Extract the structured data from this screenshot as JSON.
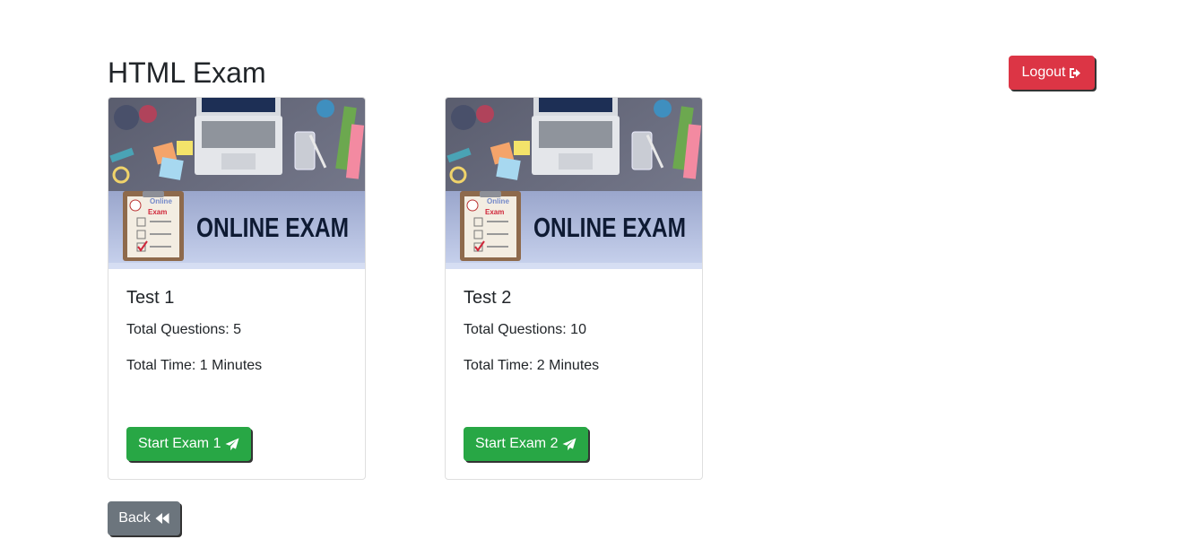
{
  "page": {
    "title": "HTML Exam"
  },
  "header": {
    "logout_label": "Logout",
    "logout_icon": "sign-out-icon"
  },
  "colors": {
    "danger": "#dc3545",
    "success": "#28a745",
    "secondary": "#6c757d"
  },
  "exams": [
    {
      "title": "Test 1",
      "total_questions": "Total Questions: 5",
      "total_time": "Total Time: 1 Minutes",
      "start_label": "Start Exam 1",
      "start_icon": "paper-plane-icon",
      "image_text": "ONLINE EXAM",
      "clipboard_text_1": "Online",
      "clipboard_text_2": "Exam"
    },
    {
      "title": "Test 2",
      "total_questions": "Total Questions: 10",
      "total_time": "Total Time: 2 Minutes",
      "start_label": "Start Exam 2",
      "start_icon": "paper-plane-icon",
      "image_text": "ONLINE EXAM",
      "clipboard_text_1": "Online",
      "clipboard_text_2": "Exam"
    }
  ],
  "footer": {
    "back_label": "Back",
    "back_icon": "backward-icon"
  }
}
